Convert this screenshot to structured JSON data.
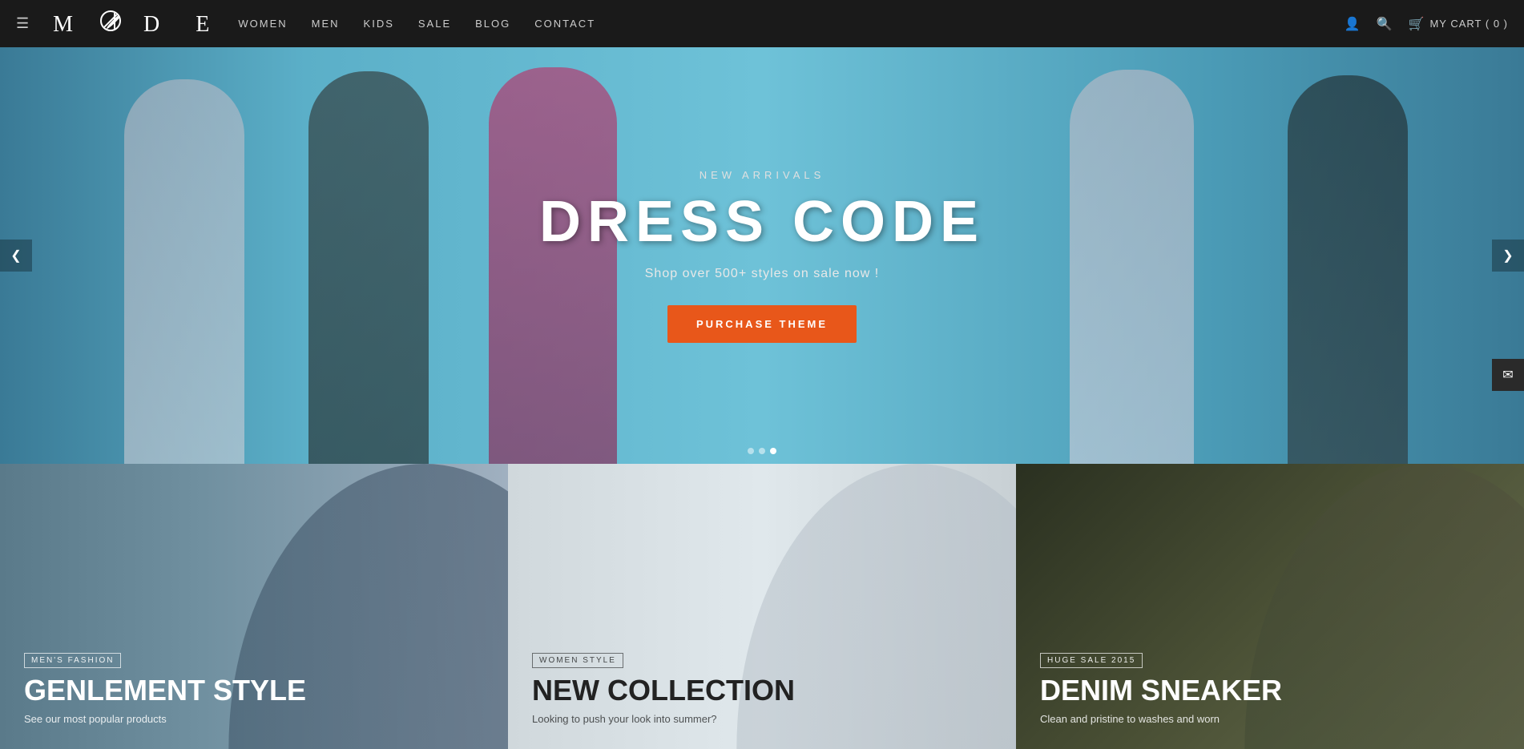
{
  "header": {
    "hamburger_icon": "☰",
    "logo": "M  D E",
    "nav": {
      "items": [
        {
          "label": "WOMEN",
          "id": "women"
        },
        {
          "label": "MEN",
          "id": "men"
        },
        {
          "label": "KIDS",
          "id": "kids"
        },
        {
          "label": "SALE",
          "id": "sale"
        },
        {
          "label": "BLOG",
          "id": "blog"
        },
        {
          "label": "CONTACT",
          "id": "contact"
        }
      ]
    },
    "cart": {
      "label": "MY CART",
      "count": "0",
      "display": "MY CART ( 0 )"
    }
  },
  "hero": {
    "subtitle": "NEW ARRIVALS",
    "title": "DRESS CODE",
    "description": "Shop over 500+ styles on sale now !",
    "cta_label": "PURCHASE THEME",
    "dots": [
      {
        "active": false
      },
      {
        "active": false
      },
      {
        "active": true
      }
    ]
  },
  "panels": [
    {
      "id": "men",
      "tag": "MEN'S FASHION",
      "title": "GENLEMENT STYLE",
      "description": "See our most popular products"
    },
    {
      "id": "women",
      "tag": "WOMEN STYLE",
      "title": "NEW COLLECTION",
      "description": "Looking to push your look into summer?"
    },
    {
      "id": "denim",
      "tag": "HUGE SALE 2015",
      "title": "DENIM SNEAKER",
      "description": "Clean and pristine to washes and worn"
    }
  ],
  "email_float": {
    "icon": "✉"
  }
}
